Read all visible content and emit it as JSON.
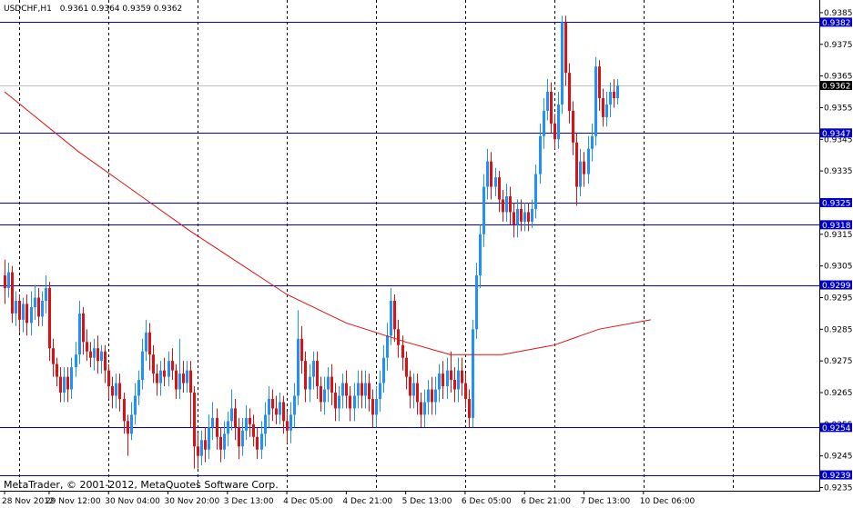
{
  "header": {
    "symbol": "USDCHF,H1",
    "ohlc": "0.9361 0.9364 0.9359 0.9362"
  },
  "copyright": "MetaTrader, © 2001-2012, MetaQuotes Software Corp.",
  "colors": {
    "up": "#1e90ff",
    "down": "#dd1111",
    "ma": "#dd1111",
    "level": "#0000cc",
    "current": "#000000"
  },
  "chart_data": {
    "type": "candlestick",
    "ylim": [
      0.9234,
      0.9389
    ],
    "y_ticks": [
      "0.9385",
      "0.9375",
      "0.9365",
      "0.9355",
      "0.9345",
      "0.9335",
      "0.9325",
      "0.9315",
      "0.9305",
      "0.9295",
      "0.9285",
      "0.9275",
      "0.9265",
      "0.9255",
      "0.9245",
      "0.9235"
    ],
    "x_labels": [
      "28 Nov 2012",
      "29 Nov 12:00",
      "30 Nov 04:00",
      "30 Nov 20:00",
      "3 Dec 13:00",
      "4 Dec 05:00",
      "4 Dec 21:00",
      "5 Dec 13:00",
      "6 Dec 05:00",
      "6 Dec 21:00",
      "7 Dec 13:00",
      "10 Dec 06:00"
    ],
    "x_label_index": [
      0,
      12,
      28,
      44,
      60,
      76,
      92,
      108,
      124,
      140,
      156,
      172
    ],
    "separators_index": [
      4,
      28,
      52,
      76,
      100,
      124,
      148,
      172,
      196
    ],
    "levels": [
      {
        "value": 0.9382,
        "label": "0.9382"
      },
      {
        "value": 0.9347,
        "label": "0.9347"
      },
      {
        "value": 0.9325,
        "label": "0.9325"
      },
      {
        "value": 0.9318,
        "label": "0.9318"
      },
      {
        "value": 0.9299,
        "label": "0.9299"
      },
      {
        "value": 0.9254,
        "label": "0.9254"
      },
      {
        "value": 0.9239,
        "label": "0.9239"
      }
    ],
    "current": {
      "value": 0.9362,
      "label": "0.9362"
    },
    "ma_anchors": [
      [
        0,
        0.936
      ],
      [
        20,
        0.9341
      ],
      [
        50,
        0.9316
      ],
      [
        76,
        0.9296
      ],
      [
        92,
        0.9287
      ],
      [
        108,
        0.9281
      ],
      [
        120,
        0.9277
      ],
      [
        134,
        0.9277
      ],
      [
        148,
        0.928
      ],
      [
        160,
        0.9285
      ],
      [
        174,
        0.9288
      ]
    ],
    "candles": [
      [
        0.9302,
        0.9298,
        0.9307,
        0.9293
      ],
      [
        0.9298,
        0.9303,
        0.9306,
        0.9295
      ],
      [
        0.9303,
        0.929,
        0.9305,
        0.9287
      ],
      [
        0.929,
        0.9294,
        0.9297,
        0.9286
      ],
      [
        0.9294,
        0.9288,
        0.9296,
        0.9284
      ],
      [
        0.9288,
        0.9293,
        0.9295,
        0.9284
      ],
      [
        0.9293,
        0.9287,
        0.9296,
        0.9283
      ],
      [
        0.9287,
        0.9292,
        0.9297,
        0.9283
      ],
      [
        0.9292,
        0.9295,
        0.9299,
        0.9288
      ],
      [
        0.9295,
        0.9289,
        0.9298,
        0.9286
      ],
      [
        0.9289,
        0.9294,
        0.9297,
        0.9286
      ],
      [
        0.9294,
        0.9298,
        0.9302,
        0.929
      ],
      [
        0.9298,
        0.9279,
        0.93,
        0.9275
      ],
      [
        0.9279,
        0.9274,
        0.9282,
        0.927
      ],
      [
        0.9274,
        0.927,
        0.9276,
        0.9267
      ],
      [
        0.927,
        0.9265,
        0.9273,
        0.9262
      ],
      [
        0.9265,
        0.927,
        0.9273,
        0.9262
      ],
      [
        0.927,
        0.9266,
        0.9273,
        0.9262
      ],
      [
        0.9266,
        0.9273,
        0.9276,
        0.9263
      ],
      [
        0.9273,
        0.9277,
        0.9281,
        0.927
      ],
      [
        0.9277,
        0.929,
        0.9294,
        0.9274
      ],
      [
        0.929,
        0.9281,
        0.9292,
        0.9277
      ],
      [
        0.9281,
        0.9278,
        0.9285,
        0.9275
      ],
      [
        0.9278,
        0.9276,
        0.9281,
        0.9273
      ],
      [
        0.9276,
        0.9279,
        0.9282,
        0.9272
      ],
      [
        0.9279,
        0.9275,
        0.9283,
        0.9271
      ],
      [
        0.9275,
        0.9278,
        0.928,
        0.9271
      ],
      [
        0.9278,
        0.9272,
        0.928,
        0.9268
      ],
      [
        0.9272,
        0.9267,
        0.9274,
        0.9263
      ],
      [
        0.9267,
        0.9264,
        0.927,
        0.926
      ],
      [
        0.9264,
        0.9268,
        0.9271,
        0.926
      ],
      [
        0.9268,
        0.9263,
        0.9271,
        0.9259
      ],
      [
        0.9263,
        0.9256,
        0.9265,
        0.9252
      ],
      [
        0.9256,
        0.9252,
        0.9258,
        0.9245
      ],
      [
        0.9252,
        0.9258,
        0.9262,
        0.925
      ],
      [
        0.9258,
        0.9264,
        0.9268,
        0.9255
      ],
      [
        0.9264,
        0.9269,
        0.9272,
        0.9261
      ],
      [
        0.9269,
        0.9278,
        0.9282,
        0.9266
      ],
      [
        0.9278,
        0.9284,
        0.9288,
        0.9275
      ],
      [
        0.9284,
        0.9277,
        0.9287,
        0.9272
      ],
      [
        0.9277,
        0.9271,
        0.928,
        0.9268
      ],
      [
        0.9271,
        0.9268,
        0.9274,
        0.9264
      ],
      [
        0.9268,
        0.9272,
        0.9275,
        0.9264
      ],
      [
        0.9272,
        0.927,
        0.9276,
        0.9267
      ],
      [
        0.927,
        0.9275,
        0.9278,
        0.9267
      ],
      [
        0.9275,
        0.9272,
        0.9279,
        0.9269
      ],
      [
        0.9272,
        0.9266,
        0.9274,
        0.9263
      ],
      [
        0.9266,
        0.9271,
        0.9282,
        0.9263
      ],
      [
        0.9271,
        0.9268,
        0.9275,
        0.9265
      ],
      [
        0.9268,
        0.9272,
        0.9275,
        0.9265
      ],
      [
        0.9272,
        0.9265,
        0.9275,
        0.9254
      ],
      [
        0.9265,
        0.9248,
        0.9267,
        0.9241
      ],
      [
        0.9248,
        0.9245,
        0.9252,
        0.9241
      ],
      [
        0.9245,
        0.925,
        0.9253,
        0.9242
      ],
      [
        0.925,
        0.9247,
        0.9254,
        0.9243
      ],
      [
        0.9247,
        0.9254,
        0.9258,
        0.9244
      ],
      [
        0.9254,
        0.9257,
        0.9262,
        0.925
      ],
      [
        0.9257,
        0.9251,
        0.926,
        0.9247
      ],
      [
        0.9251,
        0.9247,
        0.9254,
        0.9243
      ],
      [
        0.9247,
        0.9252,
        0.9256,
        0.9244
      ],
      [
        0.9252,
        0.9256,
        0.9259,
        0.9248
      ],
      [
        0.9256,
        0.926,
        0.9266,
        0.9253
      ],
      [
        0.926,
        0.9254,
        0.9263,
        0.925
      ],
      [
        0.9254,
        0.9248,
        0.9257,
        0.9244
      ],
      [
        0.9248,
        0.9253,
        0.9257,
        0.9245
      ],
      [
        0.9253,
        0.9257,
        0.9261,
        0.925
      ],
      [
        0.9257,
        0.9255,
        0.926,
        0.9251
      ],
      [
        0.9255,
        0.9251,
        0.9258,
        0.9248
      ],
      [
        0.9251,
        0.9247,
        0.9254,
        0.9244
      ],
      [
        0.9247,
        0.9252,
        0.9256,
        0.9244
      ],
      [
        0.9252,
        0.9258,
        0.9262,
        0.9248
      ],
      [
        0.9258,
        0.9263,
        0.9267,
        0.9254
      ],
      [
        0.9263,
        0.926,
        0.9266,
        0.9256
      ],
      [
        0.926,
        0.9258,
        0.9264,
        0.9255
      ],
      [
        0.9258,
        0.9262,
        0.9265,
        0.9255
      ],
      [
        0.9262,
        0.9256,
        0.9264,
        0.9252
      ],
      [
        0.9256,
        0.9253,
        0.9259,
        0.9249
      ],
      [
        0.9253,
        0.9258,
        0.9262,
        0.9249
      ],
      [
        0.9258,
        0.9264,
        0.9268,
        0.9254
      ],
      [
        0.9264,
        0.9282,
        0.9291,
        0.9261
      ],
      [
        0.9282,
        0.9275,
        0.9286,
        0.9271
      ],
      [
        0.9275,
        0.9266,
        0.9278,
        0.9262
      ],
      [
        0.9266,
        0.927,
        0.9274,
        0.9262
      ],
      [
        0.927,
        0.9275,
        0.9278,
        0.9266
      ],
      [
        0.9275,
        0.9267,
        0.9278,
        0.9263
      ],
      [
        0.9267,
        0.9262,
        0.927,
        0.9259
      ],
      [
        0.9262,
        0.9266,
        0.927,
        0.9258
      ],
      [
        0.9266,
        0.927,
        0.9273,
        0.9262
      ],
      [
        0.927,
        0.9265,
        0.9274,
        0.9261
      ],
      [
        0.9265,
        0.926,
        0.9268,
        0.9256
      ],
      [
        0.926,
        0.9264,
        0.9267,
        0.9256
      ],
      [
        0.9264,
        0.9268,
        0.9271,
        0.926
      ],
      [
        0.9268,
        0.9264,
        0.9272,
        0.926
      ],
      [
        0.9264,
        0.926,
        0.9267,
        0.9256
      ],
      [
        0.926,
        0.9264,
        0.9268,
        0.9256
      ],
      [
        0.9264,
        0.9268,
        0.9272,
        0.926
      ],
      [
        0.9268,
        0.9264,
        0.9272,
        0.926
      ],
      [
        0.9264,
        0.9268,
        0.9272,
        0.926
      ],
      [
        0.9268,
        0.9263,
        0.9271,
        0.9259
      ],
      [
        0.9263,
        0.9258,
        0.9266,
        0.9254
      ],
      [
        0.9258,
        0.9263,
        0.9267,
        0.9254
      ],
      [
        0.9263,
        0.9268,
        0.9272,
        0.9259
      ],
      [
        0.9268,
        0.9276,
        0.928,
        0.9265
      ],
      [
        0.9276,
        0.9283,
        0.9287,
        0.9272
      ],
      [
        0.9283,
        0.9294,
        0.9298,
        0.928
      ],
      [
        0.9294,
        0.9285,
        0.9296,
        0.9281
      ],
      [
        0.9285,
        0.928,
        0.9288,
        0.9276
      ],
      [
        0.928,
        0.9276,
        0.9283,
        0.9272
      ],
      [
        0.9276,
        0.927,
        0.9278,
        0.9266
      ],
      [
        0.927,
        0.9264,
        0.9272,
        0.926
      ],
      [
        0.9264,
        0.9268,
        0.9271,
        0.926
      ],
      [
        0.9268,
        0.9262,
        0.9271,
        0.9258
      ],
      [
        0.9262,
        0.9258,
        0.9265,
        0.9254
      ],
      [
        0.9258,
        0.9262,
        0.9266,
        0.9254
      ],
      [
        0.9262,
        0.9266,
        0.9269,
        0.9258
      ],
      [
        0.9266,
        0.9262,
        0.927,
        0.9258
      ],
      [
        0.9262,
        0.9266,
        0.927,
        0.9258
      ],
      [
        0.9266,
        0.9271,
        0.9274,
        0.9262
      ],
      [
        0.9271,
        0.9267,
        0.9275,
        0.9263
      ],
      [
        0.9267,
        0.9272,
        0.9276,
        0.9263
      ],
      [
        0.9272,
        0.9269,
        0.9278,
        0.9265
      ],
      [
        0.9269,
        0.9266,
        0.9273,
        0.9262
      ],
      [
        0.9266,
        0.9272,
        0.9276,
        0.9262
      ],
      [
        0.9272,
        0.9268,
        0.9276,
        0.9264
      ],
      [
        0.9268,
        0.9263,
        0.9271,
        0.926
      ],
      [
        0.9263,
        0.9257,
        0.9266,
        0.9254
      ],
      [
        0.9257,
        0.9285,
        0.9288,
        0.9254
      ],
      [
        0.9285,
        0.9302,
        0.9306,
        0.9282
      ],
      [
        0.9302,
        0.9315,
        0.9318,
        0.9298
      ],
      [
        0.9315,
        0.933,
        0.9334,
        0.9311
      ],
      [
        0.933,
        0.9338,
        0.9342,
        0.9326
      ],
      [
        0.9338,
        0.933,
        0.9341,
        0.9326
      ],
      [
        0.933,
        0.9333,
        0.9336,
        0.9327
      ],
      [
        0.9333,
        0.9326,
        0.9335,
        0.9322
      ],
      [
        0.9326,
        0.9322,
        0.9329,
        0.9319
      ],
      [
        0.9322,
        0.9327,
        0.9331,
        0.9319
      ],
      [
        0.9327,
        0.9322,
        0.933,
        0.9318
      ],
      [
        0.9322,
        0.9318,
        0.9325,
        0.9314
      ],
      [
        0.9318,
        0.9323,
        0.9326,
        0.9314
      ],
      [
        0.9323,
        0.9319,
        0.9326,
        0.9316
      ],
      [
        0.9319,
        0.9322,
        0.9325,
        0.9316
      ],
      [
        0.9322,
        0.9319,
        0.9325,
        0.9316
      ],
      [
        0.9319,
        0.9323,
        0.9326,
        0.9317
      ],
      [
        0.9323,
        0.9334,
        0.9337,
        0.932
      ],
      [
        0.9334,
        0.9346,
        0.935,
        0.9331
      ],
      [
        0.9346,
        0.9354,
        0.9358,
        0.9342
      ],
      [
        0.9354,
        0.936,
        0.9364,
        0.9351
      ],
      [
        0.936,
        0.935,
        0.9363,
        0.9347
      ],
      [
        0.935,
        0.9345,
        0.9353,
        0.9342
      ],
      [
        0.9345,
        0.9356,
        0.936,
        0.9342
      ],
      [
        0.9356,
        0.9382,
        0.9384,
        0.9353
      ],
      [
        0.9382,
        0.9366,
        0.9384,
        0.9362
      ],
      [
        0.9366,
        0.9354,
        0.9369,
        0.935
      ],
      [
        0.9354,
        0.9344,
        0.9357,
        0.934
      ],
      [
        0.9344,
        0.933,
        0.9347,
        0.9324
      ],
      [
        0.933,
        0.9338,
        0.9342,
        0.9327
      ],
      [
        0.9338,
        0.9334,
        0.9341,
        0.933
      ],
      [
        0.9334,
        0.9342,
        0.9346,
        0.9331
      ],
      [
        0.9342,
        0.9346,
        0.935,
        0.9338
      ],
      [
        0.9346,
        0.9368,
        0.9371,
        0.9343
      ],
      [
        0.9368,
        0.9358,
        0.937,
        0.9354
      ],
      [
        0.9358,
        0.9352,
        0.9361,
        0.9349
      ],
      [
        0.9352,
        0.9356,
        0.936,
        0.9349
      ],
      [
        0.9356,
        0.936,
        0.9363,
        0.9352
      ],
      [
        0.936,
        0.9358,
        0.9364,
        0.9355
      ],
      [
        0.9358,
        0.9362,
        0.9364,
        0.9356
      ]
    ]
  }
}
